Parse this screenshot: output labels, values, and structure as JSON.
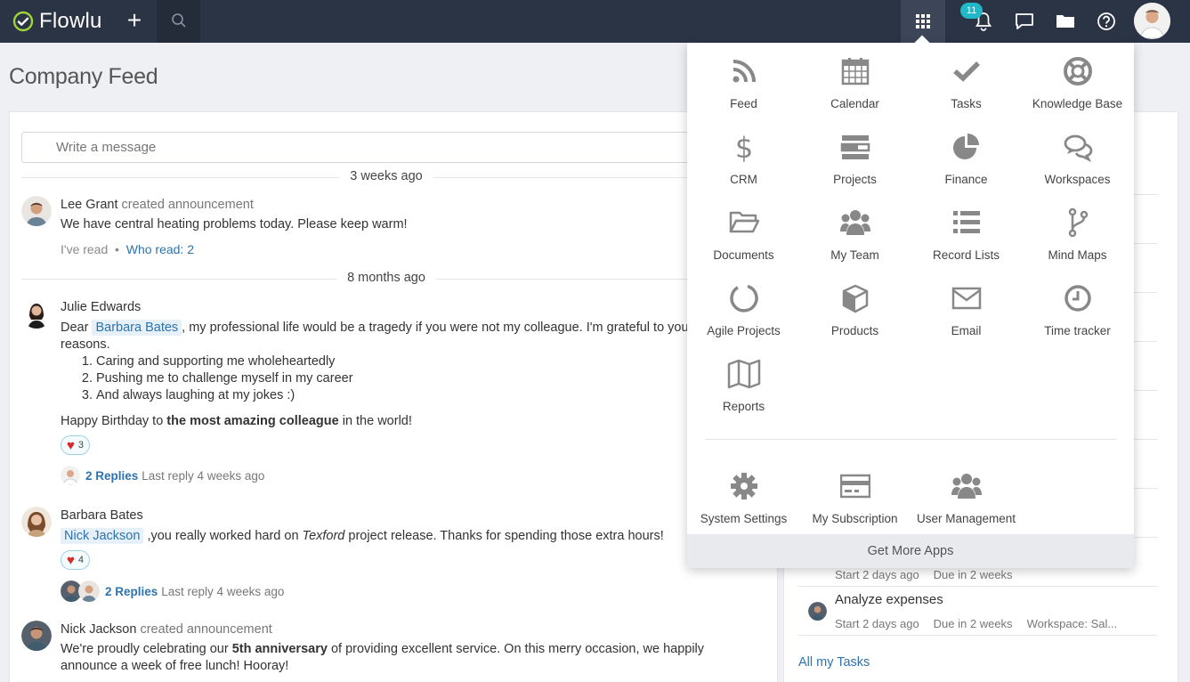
{
  "app": {
    "name": "Flowlu",
    "notification_count": "11"
  },
  "page_title": "Company Feed",
  "composer": {
    "placeholder": "Write a message"
  },
  "feed": {
    "divider_1": "3 weeks ago",
    "divider_2": "8 months ago",
    "post1": {
      "author": "Lee Grant",
      "action": "created announcement",
      "text": "We have central heating problems today. Please keep warm!",
      "read_label": "I've read",
      "sep": "•",
      "who_read": "Who read: 2"
    },
    "post2": {
      "author": "Julie Edwards",
      "text_pre": "Dear ",
      "mention": "Barbara Bates",
      "text_post": ", my professional life would be a tragedy if you were not my colleague. I'm grateful to you for many reasons.",
      "list": [
        "Caring and supporting me wholeheartedly",
        "Pushing me to challenge myself in my career",
        "And always laughing at my jokes :)"
      ],
      "bday_pre": "Happy Birthday to ",
      "bday_bold": "the most amazing colleague",
      "bday_post": " in the world!",
      "likes": "3",
      "replies": "2 Replies",
      "last_reply": "Last reply 4 weeks ago"
    },
    "post3": {
      "author": "Barbara Bates",
      "mention": "Nick Jackson",
      "text_pre": " ,you really worked hard on ",
      "text_em": "Texford",
      "text_post": " project release. Thanks for spending those extra hours!",
      "likes": "4",
      "replies": "2 Replies",
      "last_reply": "Last reply 4 weeks ago"
    },
    "post4": {
      "author": "Nick Jackson",
      "action": "created announcement",
      "text_pre": "We're proudly celebrating our ",
      "text_bold": "5th anniversary",
      "text_post": " of providing excellent service. On this merry occasion, we happily announce a week of free lunch! Hooray!"
    }
  },
  "tasks": {
    "row1": {
      "start": "Start  2 days ago",
      "due": "Due  in 2 weeks"
    },
    "row2": {
      "title": "Analyze expenses",
      "start": "Start  2 days ago",
      "due": "Due  in 2 weeks",
      "workspace": "Workspace: Sal..."
    },
    "all_link": "All my Tasks"
  },
  "apps_menu": {
    "apps": [
      {
        "label": "Feed",
        "icon": "rss-icon"
      },
      {
        "label": "Calendar",
        "icon": "calendar-icon"
      },
      {
        "label": "Tasks",
        "icon": "check-icon"
      },
      {
        "label": "Knowledge Base",
        "icon": "lifebuoy-icon"
      },
      {
        "label": "CRM",
        "icon": "dollar-icon"
      },
      {
        "label": "Projects",
        "icon": "projects-icon"
      },
      {
        "label": "Finance",
        "icon": "pie-chart-icon"
      },
      {
        "label": "Workspaces",
        "icon": "chat-bubbles-icon"
      },
      {
        "label": "Documents",
        "icon": "folder-icon"
      },
      {
        "label": "My Team",
        "icon": "team-icon"
      },
      {
        "label": "Record Lists",
        "icon": "list-icon"
      },
      {
        "label": "Mind Maps",
        "icon": "branch-icon"
      },
      {
        "label": "Agile Projects",
        "icon": "circle-icon"
      },
      {
        "label": "Products",
        "icon": "box-icon"
      },
      {
        "label": "Email",
        "icon": "envelope-icon"
      },
      {
        "label": "Time tracker",
        "icon": "clock-icon"
      },
      {
        "label": "Reports",
        "icon": "map-icon"
      }
    ],
    "admin": [
      {
        "label": "System Settings",
        "icon": "gear-icon"
      },
      {
        "label": "My Subscription",
        "icon": "credit-card-icon"
      },
      {
        "label": "User Management",
        "icon": "users-icon"
      }
    ],
    "more": "Get More Apps"
  }
}
